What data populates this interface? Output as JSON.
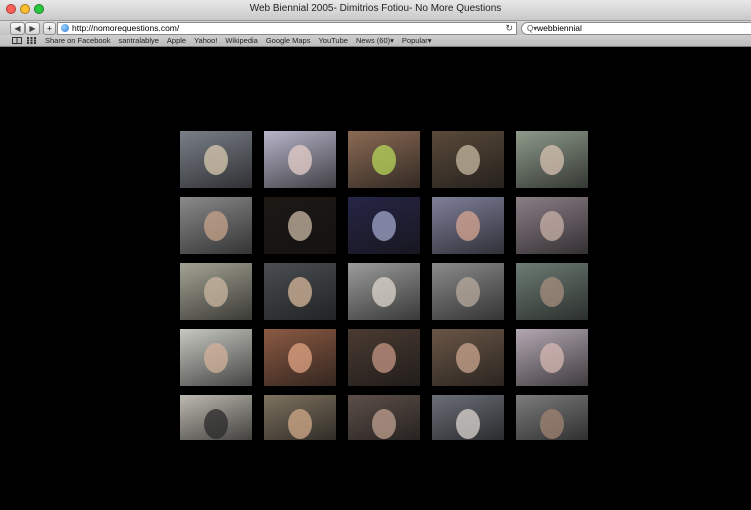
{
  "window": {
    "title": "Web Biennial 2005- Dimitrios Fotiou- No More Questions"
  },
  "toolbar": {
    "back_icon": "back-arrow-icon",
    "forward_icon": "forward-arrow-icon",
    "add_icon": "plus-icon",
    "url": "http://nomorequestions.com/",
    "reload_icon": "reload-icon",
    "search_value": "webbiennial",
    "search_icon_glyph": "Q▾"
  },
  "bookmarks": {
    "items": [
      "Share on Facebook",
      "santralablye",
      "Apple",
      "Yahoo!",
      "Wikipedia",
      "Google Maps",
      "YouTube",
      "News (60)▾",
      "Popular▾"
    ]
  },
  "webcam_grid": {
    "rows": 5,
    "columns": 5,
    "tiles": [
      {
        "bg": "#7a7f88",
        "accent": "#d9c9b0"
      },
      {
        "bg": "#b7b5c9",
        "accent": "#e6cfc9"
      },
      {
        "bg": "#8a6a54",
        "accent": "#b7d55a"
      },
      {
        "bg": "#5a4a3a",
        "accent": "#c7b9a1"
      },
      {
        "bg": "#8e9a8a",
        "accent": "#d7c2b0"
      },
      {
        "bg": "#8a8a8a",
        "accent": "#c7a38a"
      },
      {
        "bg": "#1c1814",
        "accent": "#c9b8a6"
      },
      {
        "bg": "#262545",
        "accent": "#a2a6c9"
      },
      {
        "bg": "#7f7f9a",
        "accent": "#d5a592"
      },
      {
        "bg": "#8b7e86",
        "accent": "#c8b0a8"
      },
      {
        "bg": "#a3a394",
        "accent": "#cbb7a1"
      },
      {
        "bg": "#4a4e52",
        "accent": "#d7b89b"
      },
      {
        "bg": "#9c9c9c",
        "accent": "#dcd5cb"
      },
      {
        "bg": "#8b8b8b",
        "accent": "#b8a99c"
      },
      {
        "bg": "#6d7c74",
        "accent": "#a58d7d"
      },
      {
        "bg": "#c8c8c2",
        "accent": "#d3b09a"
      },
      {
        "bg": "#8b5a43",
        "accent": "#e0a484"
      },
      {
        "bg": "#4a3b32",
        "accent": "#c49584"
      },
      {
        "bg": "#6a5646",
        "accent": "#caa690"
      },
      {
        "bg": "#b4a8b2",
        "accent": "#d6b8b3"
      },
      {
        "bg": "#bdbab0",
        "accent": "#2a2a2a"
      },
      {
        "bg": "#7e725f",
        "accent": "#d2a98a"
      },
      {
        "bg": "#5d4f48",
        "accent": "#bea08f"
      },
      {
        "bg": "#6c6f78",
        "accent": "#d9d4cf"
      },
      {
        "bg": "#7c7c7c",
        "accent": "#a08272"
      }
    ]
  },
  "colors": {
    "close": "#ff5f57",
    "minimize": "#ffbd2e",
    "zoom": "#28c840",
    "page_background": "#000000"
  }
}
